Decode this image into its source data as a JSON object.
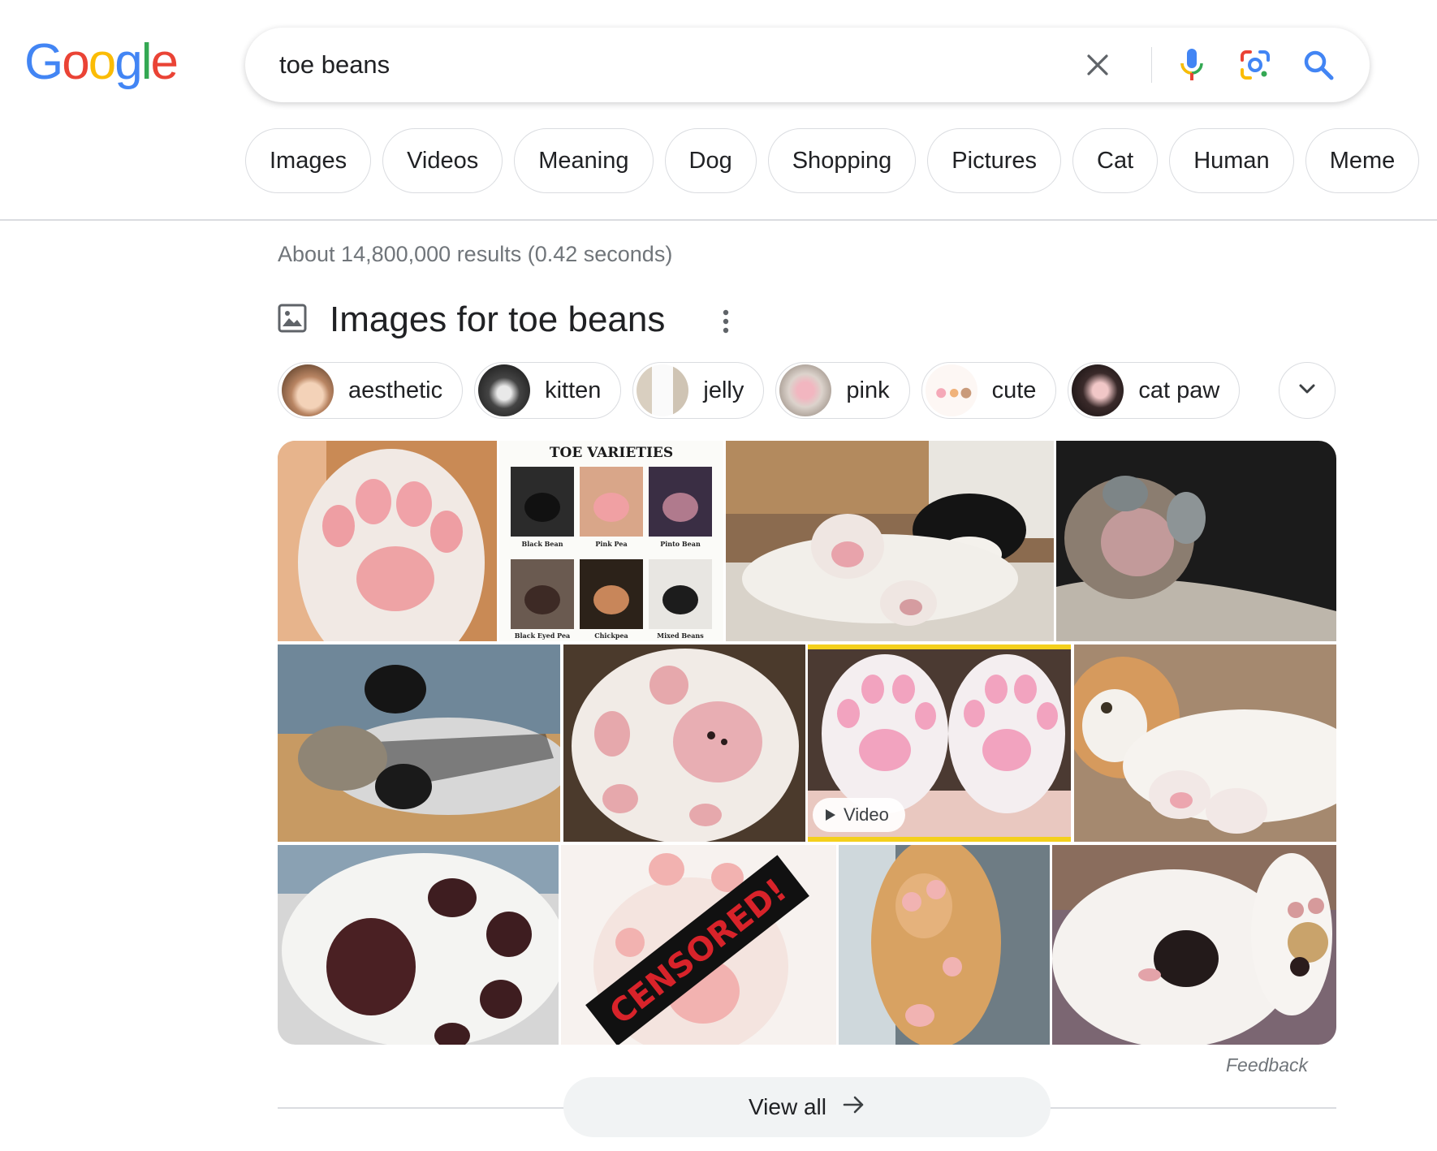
{
  "logo": {
    "letters": [
      "G",
      "o",
      "o",
      "g",
      "l",
      "e"
    ],
    "colors": [
      "#4285F4",
      "#EA4335",
      "#FBBC05",
      "#4285F4",
      "#34A853",
      "#EA4335"
    ]
  },
  "search": {
    "query": "toe beans",
    "icons": [
      "close-icon",
      "mic-icon",
      "lens-icon",
      "search-icon"
    ]
  },
  "filters": [
    "Images",
    "Videos",
    "Meaning",
    "Dog",
    "Shopping",
    "Pictures",
    "Cat",
    "Human",
    "Meme"
  ],
  "results": {
    "stats": "About 14,800,000 results (0.42 seconds)"
  },
  "images_section": {
    "title": "Images for toe beans",
    "refinements": [
      "aesthetic",
      "kitten",
      "jelly",
      "pink",
      "cute",
      "cat paw"
    ],
    "video_badge": "Video",
    "feedback": "Feedback",
    "view_all": "View all",
    "tile_texts": {
      "toe_varieties_title": "TOE VARIETIES",
      "toe_varieties_labels": [
        "Black Bean",
        "Pink Pea",
        "Pinto Bean",
        "Black Eyed Pea",
        "Chickpea",
        "Mixed Beans"
      ],
      "censored": "CENSORED!"
    }
  },
  "colors": {
    "border": "#dadce0",
    "muted_text": "#70757a",
    "search_blue": "#4285F4",
    "view_all_bg": "#f1f3f4"
  }
}
